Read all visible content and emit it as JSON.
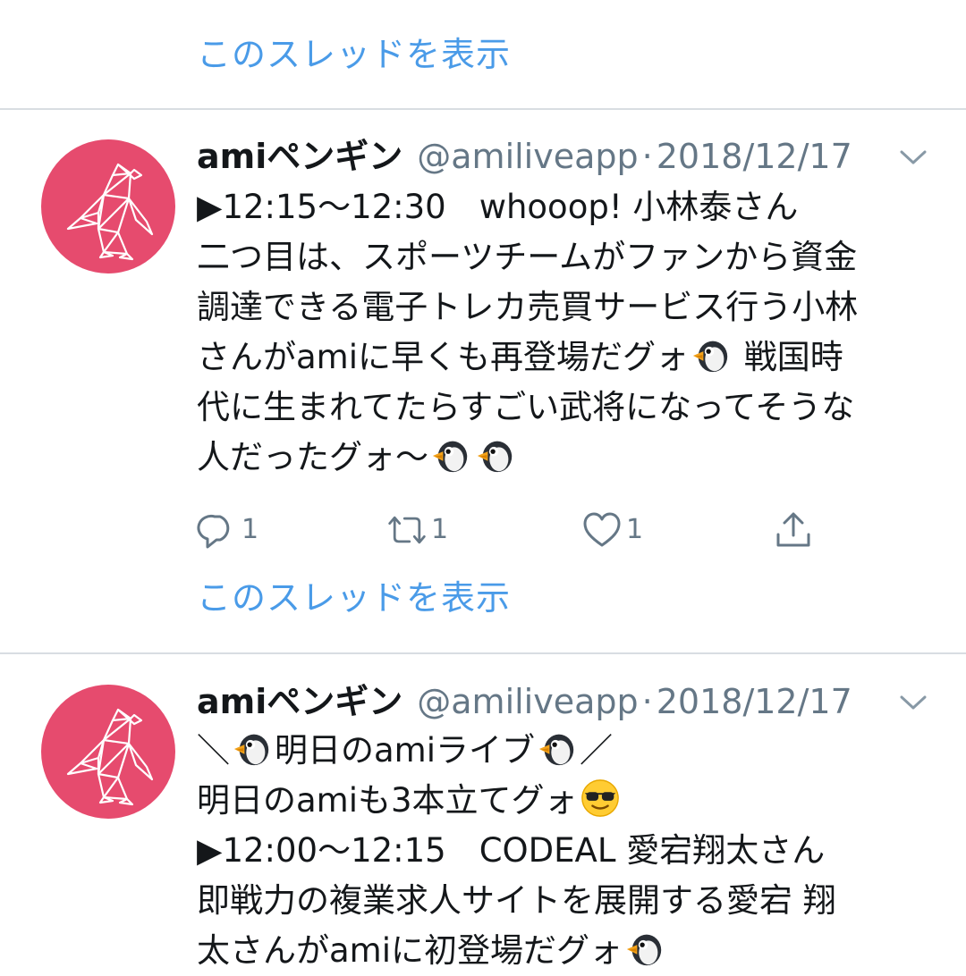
{
  "thread_link_label": "このスレッドを表示",
  "colors": {
    "link": "#4a9be8",
    "avatar": "#e64b6e",
    "muted": "#657786",
    "divider": "#d8dde2"
  },
  "tweets": [
    {
      "display_name": "amiペンギン",
      "handle": "@amiliveapp",
      "separator": "·",
      "date": "2018/12/17",
      "lines": [
        {
          "text": "▶12:15〜12:30　whooop! 小林泰さん"
        },
        {
          "text": "二つ目は、スポーツチームがファンから資金"
        },
        {
          "text": "調達できる電子トレカ売買サービス行う小林"
        },
        {
          "text": "さんがamiに早くも再登場だグォ",
          "emoji_after": "penguin-emoji",
          "after_text": " 戦国時"
        },
        {
          "text": "代に生まれてたらすごい武将になってそうな"
        },
        {
          "text": "人だったグォ〜",
          "emoji_after": "penguin-emoji-x2"
        }
      ],
      "reply_count": "1",
      "retweet_count": "1",
      "like_count": "1",
      "icons": [
        "reply-icon",
        "retweet-icon",
        "like-icon",
        "share-icon"
      ]
    },
    {
      "display_name": "amiペンギン",
      "handle": "@amiliveapp",
      "separator": "·",
      "date": "2018/12/17",
      "lines": [
        {
          "text_before": "＼",
          "text": "明日のamiライブ",
          "text_after": "／"
        },
        {
          "text": "明日のamiも3本立てグォ",
          "emoji_after": "sunglasses-emoji"
        },
        {
          "text": "▶12:00〜12:15　CODEAL 愛宕翔太さん"
        },
        {
          "text": "即戦力の複業求人サイトを展開する愛宕 翔"
        },
        {
          "text": "太さんがamiに初登場だグォ",
          "emoji_after": "penguin-emoji"
        }
      ]
    }
  ]
}
